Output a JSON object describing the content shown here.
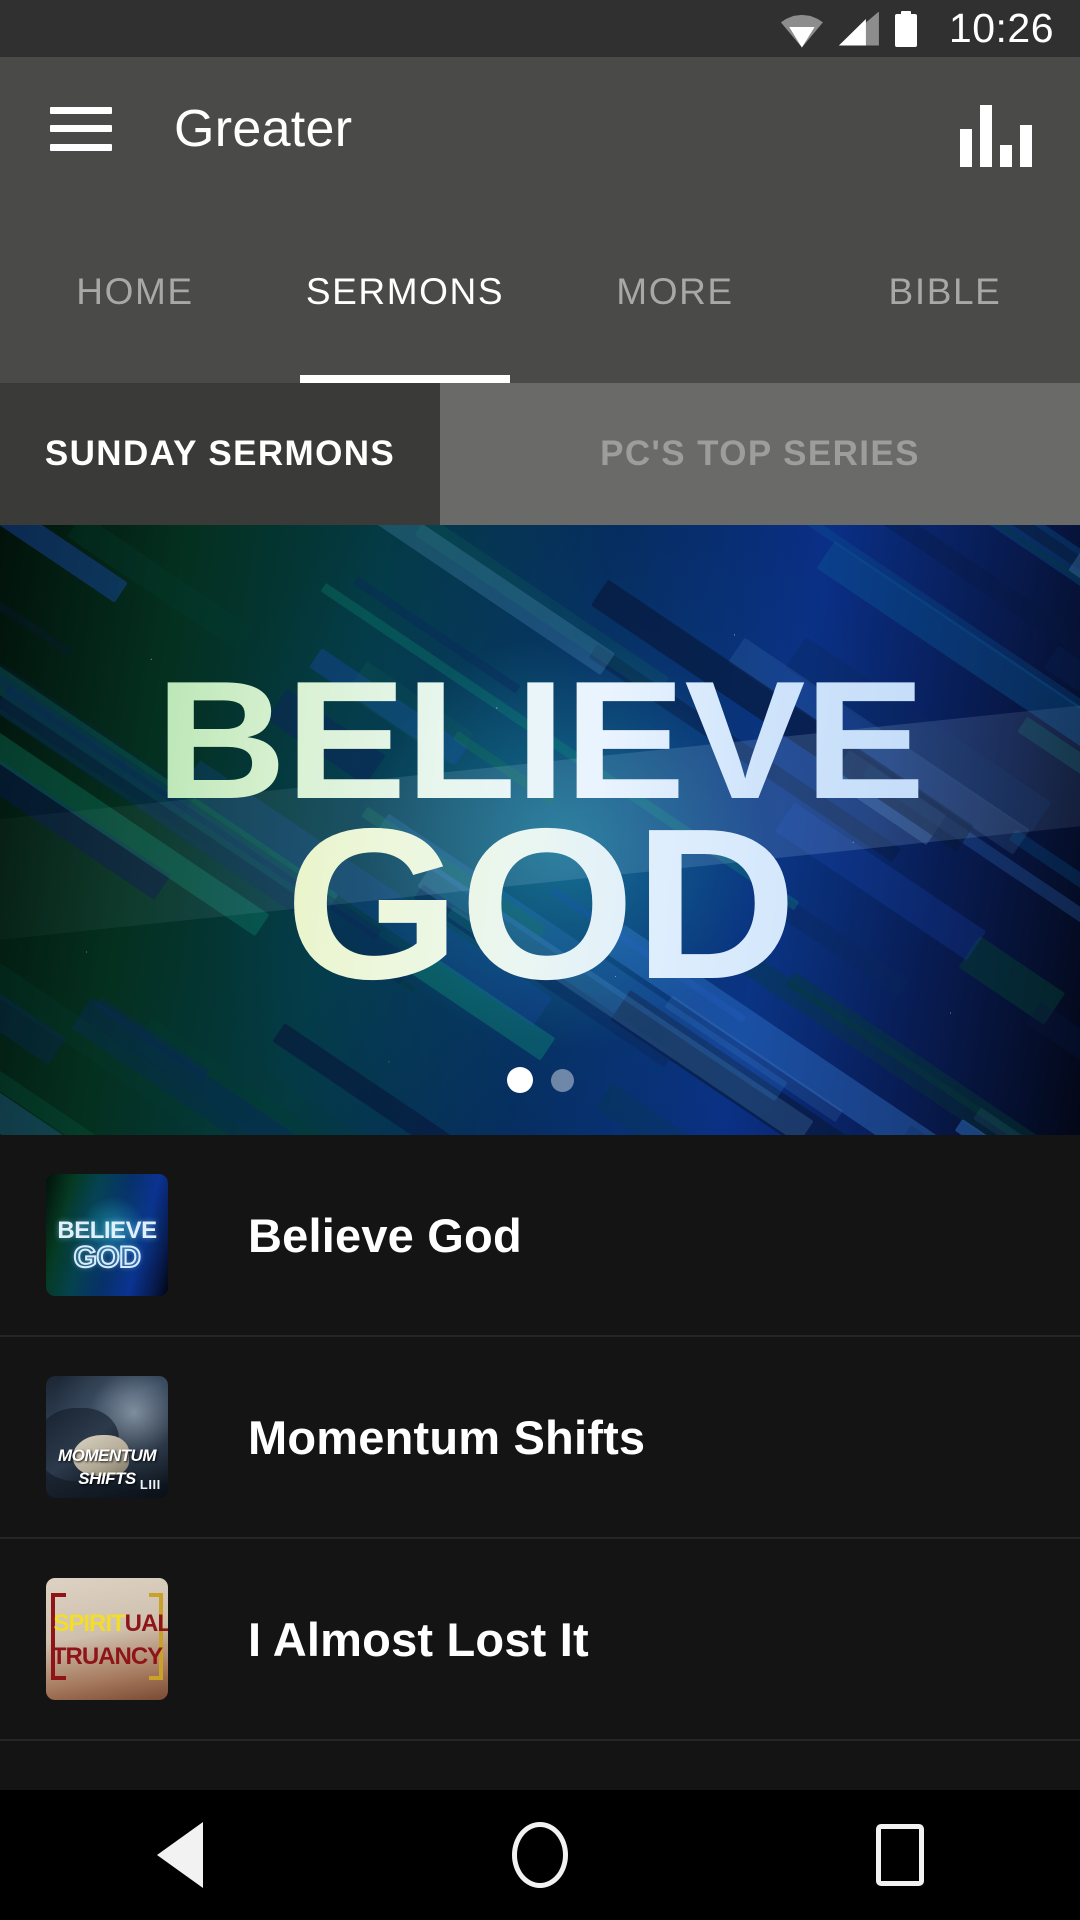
{
  "status_bar": {
    "time": "10:26",
    "icons": [
      "wifi-icon",
      "cellular-signal-icon",
      "battery-icon"
    ]
  },
  "app_bar": {
    "menu_icon": "hamburger-menu-icon",
    "title": "Greater",
    "action_icon": "equalizer-icon"
  },
  "tabs": [
    {
      "label": "HOME",
      "active": false
    },
    {
      "label": "SERMONS",
      "active": true
    },
    {
      "label": "MORE",
      "active": false
    },
    {
      "label": "BIBLE",
      "active": false
    }
  ],
  "subtabs": [
    {
      "label": "SUNDAY SERMONS",
      "active": true
    },
    {
      "label": "PC'S TOP SERIES",
      "active": false
    }
  ],
  "hero": {
    "line1": "BELIEVE",
    "line2": "GOD",
    "pager": {
      "count": 2,
      "current": 1
    }
  },
  "series_list": [
    {
      "title": "Believe God",
      "thumb": "believe-god-artwork",
      "art_text": {
        "line1": "BELIEVE",
        "line2": "GOD"
      }
    },
    {
      "title": "Momentum Shifts",
      "thumb": "momentum-shifts-artwork",
      "art_text": {
        "line1": "MOMENTUM",
        "line2": "SHIFTS",
        "badge": "LIII"
      }
    },
    {
      "title": "I Almost Lost It",
      "thumb": "spiritual-truancy-artwork",
      "art_text": {
        "line1a": "SPIRIT",
        "line1b": "UAL",
        "line2": "TRUANCY"
      }
    }
  ],
  "nav_bar": {
    "back": "back-icon",
    "home": "home-icon",
    "recents": "recents-icon"
  },
  "colors": {
    "status_bar_bg": "#303030",
    "app_bar_bg": "#4a4a48",
    "subtab_active_bg": "#3a3a38",
    "subtab_inactive_bg": "#6a6a68",
    "list_bg": "#141414",
    "accent_text": "#ffffff"
  }
}
